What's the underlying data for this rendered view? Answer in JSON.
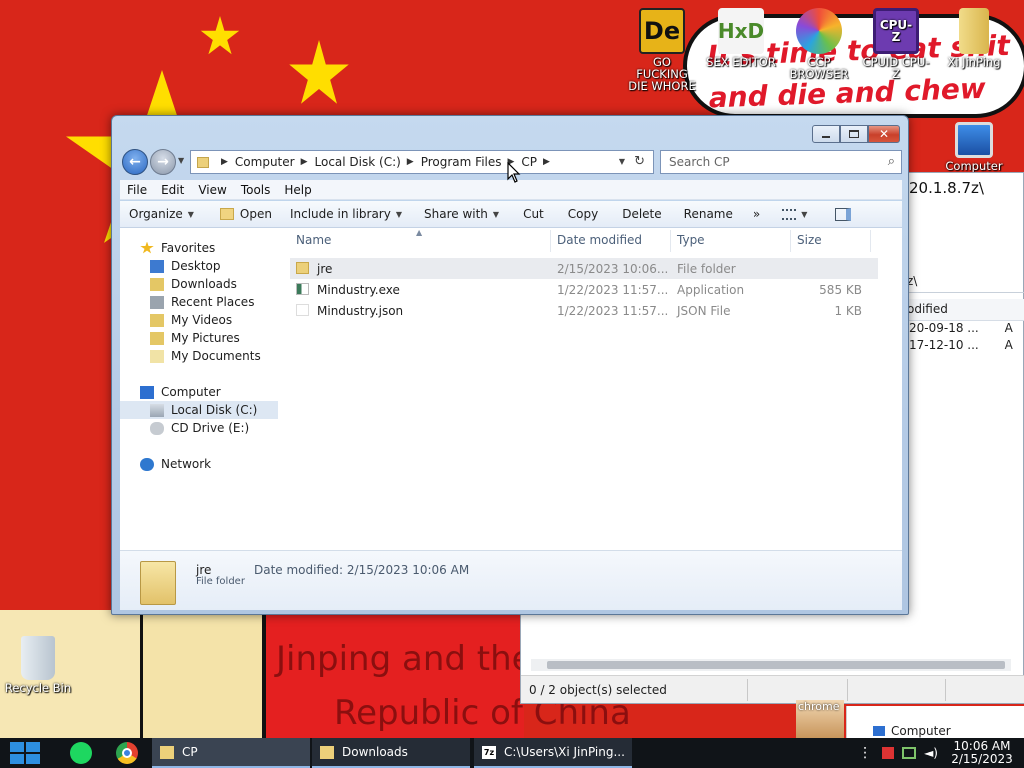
{
  "desktop": {
    "bubble_text": "It's time to eat shit\nand die and chew",
    "poster_line1": "Jinping and the",
    "poster_line2": "Republic of China",
    "icons": [
      {
        "name": "de-icon",
        "label": "GO FUCKING DIE WHORE",
        "color": "#e7b318"
      },
      {
        "name": "hxd-icon",
        "label": "SEX EDITOR",
        "color": "#f4f4f4"
      },
      {
        "name": "ccp-browser-icon",
        "label": "CCP BROWSER",
        "color": "#ee7a2b"
      },
      {
        "name": "cpuz-icon",
        "label": "CPUID CPU-Z",
        "color": "#6d3bb0"
      },
      {
        "name": "user-folder-icon",
        "label": "Xi JinPing",
        "color": "#e8cf75"
      }
    ],
    "computer_icon_label": "Computer",
    "partial_icon_label": "...re",
    "recycle_bin_label": "Recycle Bin",
    "chrome_label": "chrome"
  },
  "bg_window": {
    "path_fragment": "20.1.8.7z\\",
    "path_fragment2": "z\\",
    "col_header": "odified",
    "rows": [
      {
        "date": "20-09-18 ...",
        "attr": "A"
      },
      {
        "date": "17-12-10 ...",
        "attr": "A"
      }
    ],
    "status": "0 / 2 object(s) selected",
    "side_item": "Computer"
  },
  "explorer": {
    "breadcrumb": [
      "Computer",
      "Local Disk (C:)",
      "Program Files",
      "CP"
    ],
    "search_placeholder": "Search CP",
    "menu": [
      "File",
      "Edit",
      "View",
      "Tools",
      "Help"
    ],
    "toolbar": {
      "organize": "Organize",
      "open": "Open",
      "include": "Include in library",
      "share": "Share with",
      "cut": "Cut",
      "copy": "Copy",
      "delete": "Delete",
      "rename": "Rename",
      "more": "»"
    },
    "nav": {
      "favorites": "Favorites",
      "favorites_items": [
        "Desktop",
        "Downloads",
        "Recent Places",
        "My Videos",
        "My Pictures",
        "My Documents"
      ],
      "computer": "Computer",
      "computer_items": [
        "Local Disk (C:)",
        "CD Drive (E:)"
      ],
      "network": "Network"
    },
    "columns": {
      "name": "Name",
      "date": "Date modified",
      "type": "Type",
      "size": "Size"
    },
    "files": [
      {
        "name": "jre",
        "date": "2/15/2023 10:06...",
        "type": "File folder",
        "size": "",
        "icon": "folder-icon"
      },
      {
        "name": "Mindustry.exe",
        "date": "1/22/2023 11:57...",
        "type": "Application",
        "size": "585 KB",
        "icon": "exe-icon"
      },
      {
        "name": "Mindustry.json",
        "date": "1/22/2023 11:57...",
        "type": "JSON File",
        "size": "1 KB",
        "icon": "json-file-icon"
      }
    ],
    "details": {
      "name": "jre",
      "subtitle": "File folder",
      "modified": "Date modified: 2/15/2023 10:06 AM"
    }
  },
  "taskbar": {
    "tasks": [
      {
        "label": "CP"
      },
      {
        "label": "Downloads"
      },
      {
        "label": "C:\\Users\\Xi JinPing..."
      }
    ],
    "time": "10:06 AM",
    "date": "2/15/2023"
  }
}
